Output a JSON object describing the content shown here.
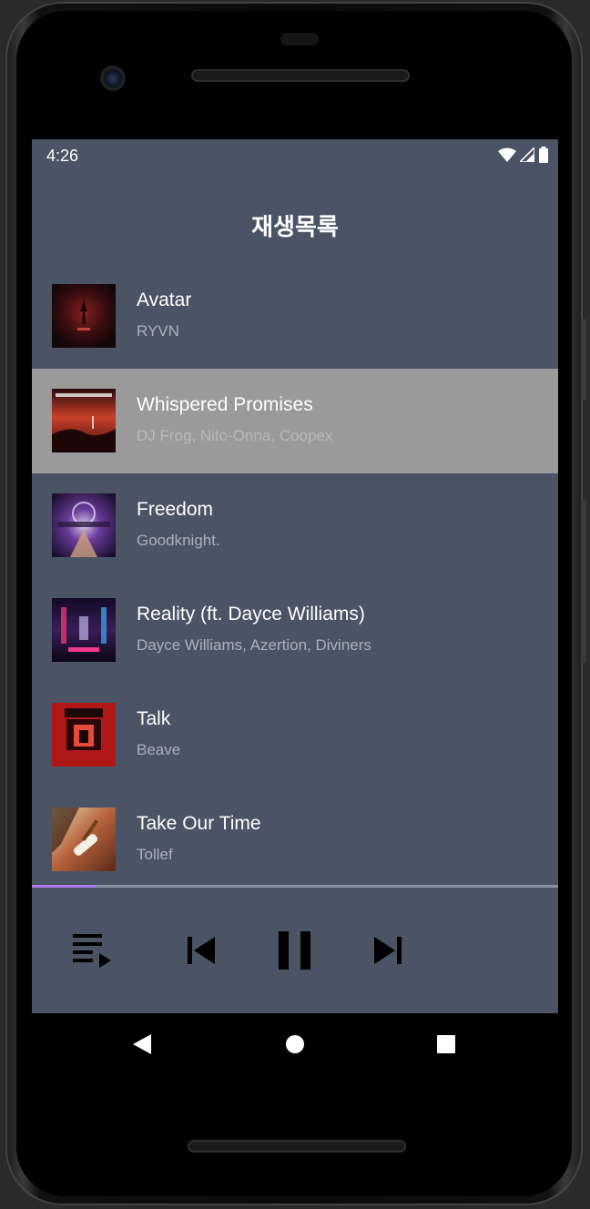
{
  "status": {
    "time": "4:26"
  },
  "header": {
    "title": "재생목록"
  },
  "playlist": [
    {
      "title": "Avatar",
      "artist": "RYVN",
      "selected": false
    },
    {
      "title": "Whispered Promises",
      "artist": "DJ Frog, Nito-Onna, Coopex",
      "selected": true
    },
    {
      "title": "Freedom",
      "artist": "Goodknight.",
      "selected": false
    },
    {
      "title": "Reality (ft. Dayce Williams)",
      "artist": "Dayce Williams, Azertion, Diviners",
      "selected": false
    },
    {
      "title": "Talk",
      "artist": "Beave",
      "selected": false
    },
    {
      "title": "Take Our Time",
      "artist": "Tollef",
      "selected": false
    }
  ],
  "player": {
    "progress": 0.12,
    "state": "playing",
    "buttons": [
      "playlist-icon",
      "previous-icon",
      "pause-icon",
      "next-icon"
    ]
  },
  "colors": {
    "background": "#4a5464",
    "selected_row": "#9a9a9a",
    "progress_accent": "#b07cf0",
    "artist_text": "#a9b0bb"
  }
}
